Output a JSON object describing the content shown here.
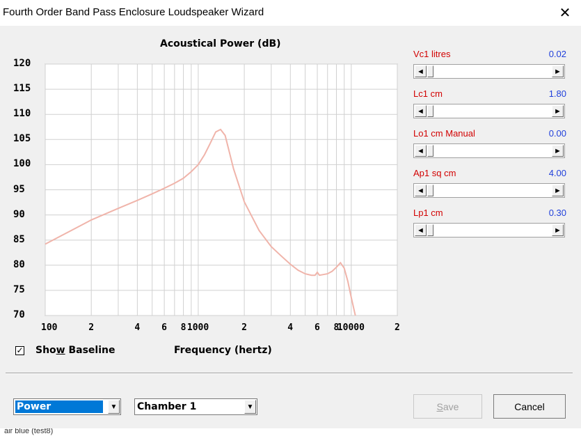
{
  "window": {
    "title": "Fourth Order Band Pass Enclosure Loudspeaker Wizard",
    "close_glyph": "✕"
  },
  "chart": {
    "title": "Acoustical Power (dB)",
    "xlabel": "Frequency (hertz)",
    "y_ticks": [
      "120",
      "115",
      "110",
      "105",
      "100",
      "95",
      "90",
      "85",
      "80",
      "75",
      "70"
    ],
    "x_ticks": [
      "100",
      "2",
      "4",
      "6",
      "8",
      "1000",
      "2",
      "4",
      "6",
      "8",
      "10000",
      "2"
    ]
  },
  "chart_data": {
    "type": "line",
    "title": "Acoustical Power (dB)",
    "xlabel": "Frequency (hertz)",
    "ylabel": "",
    "xscale": "log",
    "xlim": [
      100,
      20000
    ],
    "ylim": [
      70,
      120
    ],
    "grid": true,
    "series": [
      {
        "color": "#f0b4aa",
        "x": [
          90,
          100,
          150,
          200,
          300,
          400,
          500,
          600,
          700,
          800,
          900,
          1000,
          1100,
          1200,
          1300,
          1400,
          1500,
          1700,
          2000,
          2500,
          3000,
          3500,
          4000,
          4500,
          5000,
          5500,
          5800,
          6000,
          6200,
          7000,
          7500,
          8000,
          8500,
          9000,
          9500,
          10000,
          11000
        ],
        "y": [
          83.2,
          84.2,
          87.0,
          89.0,
          91.3,
          92.9,
          94.2,
          95.3,
          96.3,
          97.3,
          98.6,
          100.0,
          102.0,
          104.3,
          106.5,
          107.0,
          105.8,
          99.2,
          92.6,
          86.9,
          83.7,
          81.8,
          80.2,
          79.0,
          78.3,
          78.0,
          78.0,
          78.6,
          78.0,
          78.3,
          78.8,
          79.6,
          80.5,
          79.4,
          76.8,
          73.6,
          68.0
        ]
      }
    ]
  },
  "checkbox": {
    "checked_glyph": "✓",
    "label_pre": "Sho",
    "label_u": "w",
    "label_post": " Baseline"
  },
  "params": [
    {
      "label": "Vc1  litres",
      "value": "0.02",
      "fraction": 0.0
    },
    {
      "label": "Lc1  cm",
      "value": "1.80",
      "fraction": 0.0
    },
    {
      "label": "Lo1  cm  Manual",
      "value": "0.00",
      "fraction": 0.0
    },
    {
      "label": "Ap1  sq cm",
      "value": "4.00",
      "fraction": 0.0
    },
    {
      "label": "Lp1  cm",
      "value": "0.30",
      "fraction": 0.0
    }
  ],
  "scroll_arrows": {
    "left": "◄",
    "right": "►"
  },
  "combo_view": {
    "value": "Power",
    "arrow": "▼"
  },
  "combo_chamber": {
    "value": "Chamber 1",
    "arrow": "▼"
  },
  "buttons": {
    "save_u": "S",
    "save_rest": "ave",
    "cancel": "Cancel"
  },
  "bottom_strip_text": "air blue (test8)"
}
